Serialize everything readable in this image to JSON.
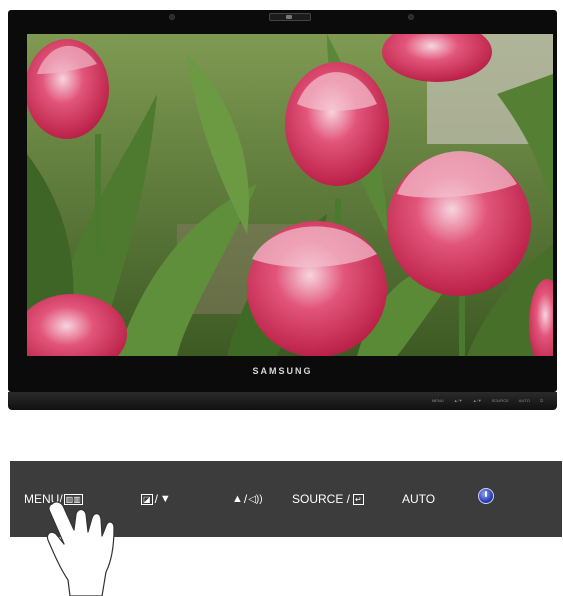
{
  "monitor": {
    "brand": "SAMSUNG",
    "base_labels": [
      "MENU",
      "▲/▼",
      "▲/▼",
      "SOURCE",
      "AUTO",
      "⏻"
    ],
    "screen_image": "red-tulips-photo"
  },
  "panel": {
    "menu_label": "MENU/",
    "menu_icon": "menu-box-icon",
    "brightness_icon": "magic-bright-icon",
    "down_arrow": "▼",
    "up_arrow": "▲",
    "volume_icon": "volume-icon",
    "sep1": "/",
    "sep2": "/",
    "source_label": "SOURCE /",
    "source_icon": "enter-icon",
    "auto_label": "AUTO",
    "power_icon": "power-icon"
  },
  "colors": {
    "bezel": "#0b0b0b",
    "panel": "#3c3c3c",
    "power": "#2e3fb3",
    "tulip": "#d81f46"
  }
}
